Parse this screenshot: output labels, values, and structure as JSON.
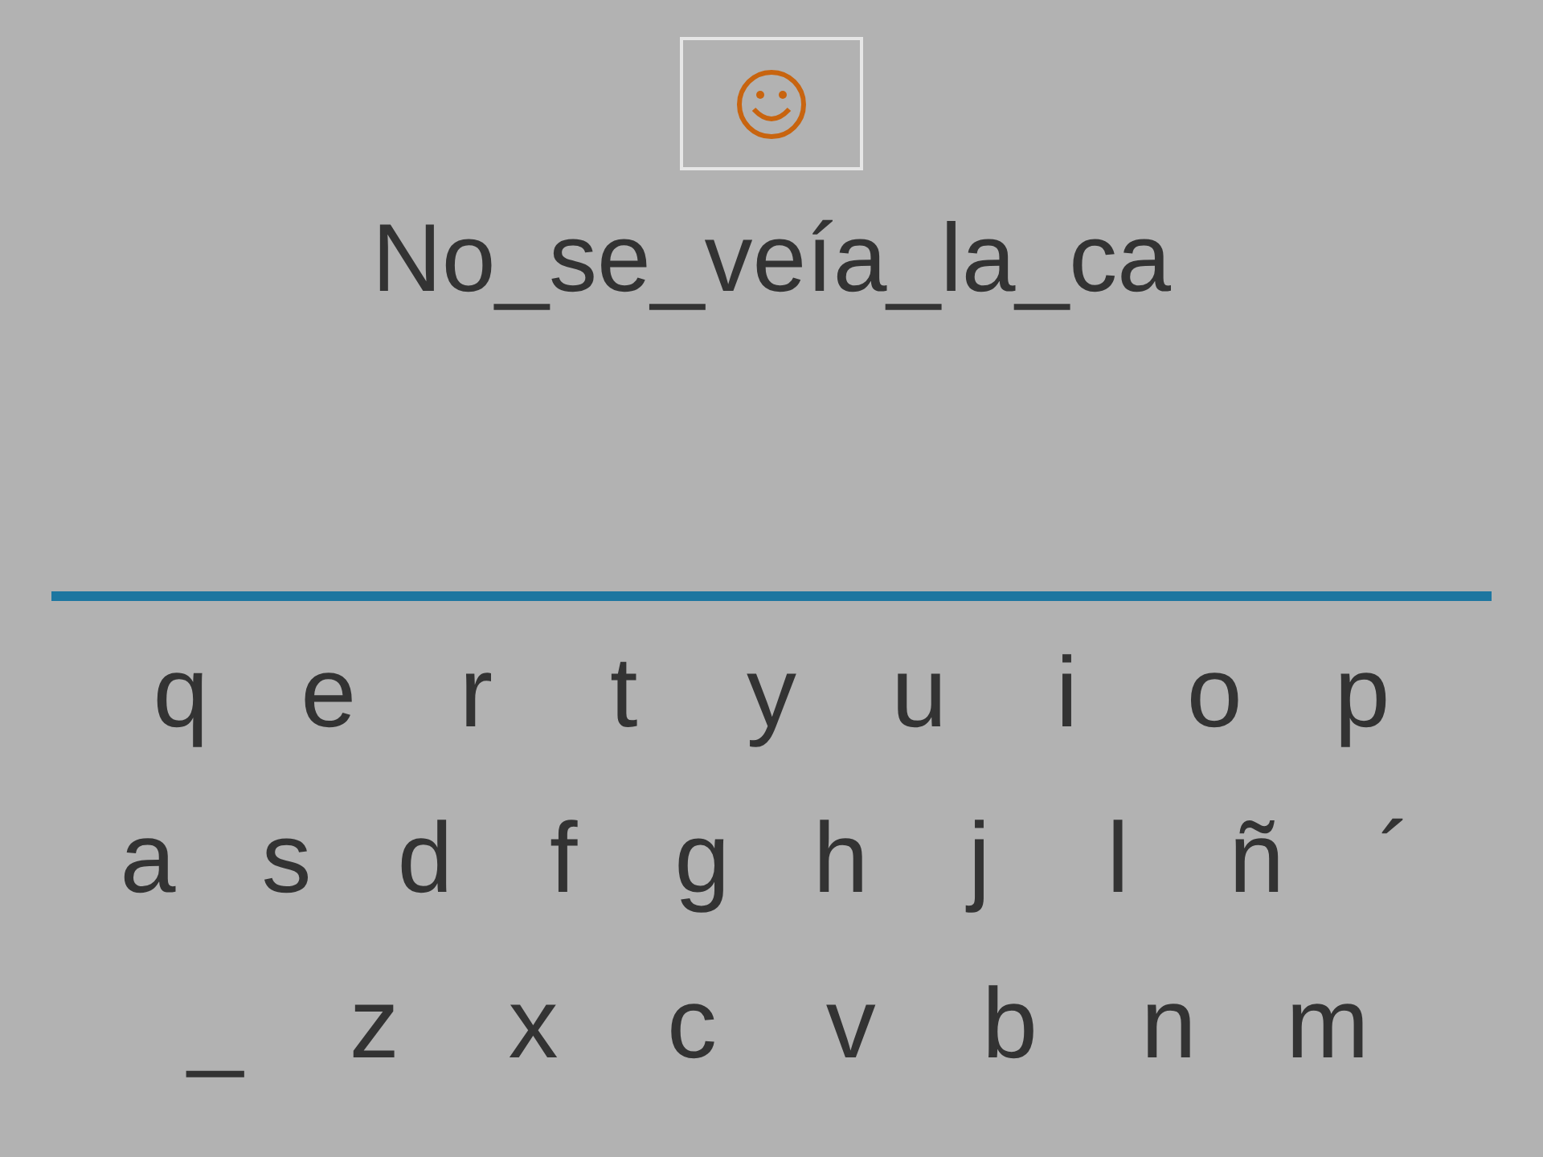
{
  "phrase": "No_se_veía_la_ca",
  "keyboard": {
    "rows": [
      [
        "q",
        "e",
        "r",
        "t",
        "y",
        "u",
        "i",
        "o",
        "p"
      ],
      [
        "a",
        "s",
        "d",
        "f",
        "g",
        "h",
        "j",
        "l",
        "ñ",
        "´"
      ],
      [
        "_",
        "z",
        "x",
        "c",
        "v",
        "b",
        "n",
        "m"
      ]
    ]
  }
}
